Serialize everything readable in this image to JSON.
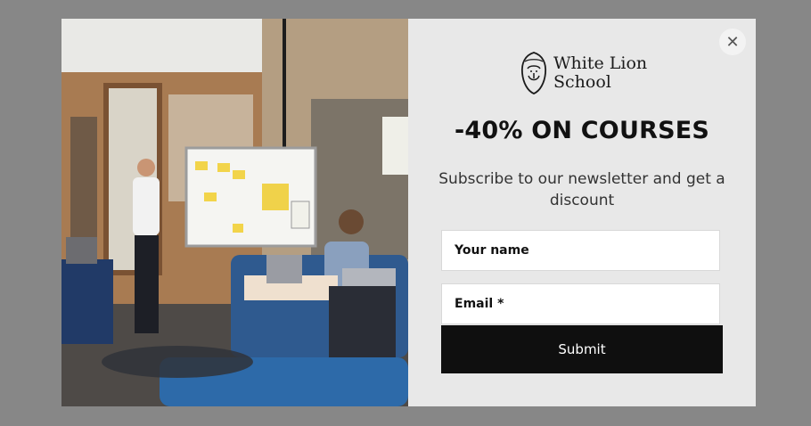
{
  "popup": {
    "logo_text": "White Lion School",
    "headline": "-40% ON COURSES",
    "subtitle": "Subscribe to our newsletter and get a discount",
    "name_placeholder": "Your name",
    "email_placeholder": "Email *",
    "submit_label": "Submit",
    "close_symbol": "✕"
  },
  "icons": {
    "close": "close-icon",
    "logo": "lion-logo-icon"
  },
  "colors": {
    "overlay": "#878787",
    "panel": "#e8e8e8",
    "button": "#0f0f0f"
  }
}
